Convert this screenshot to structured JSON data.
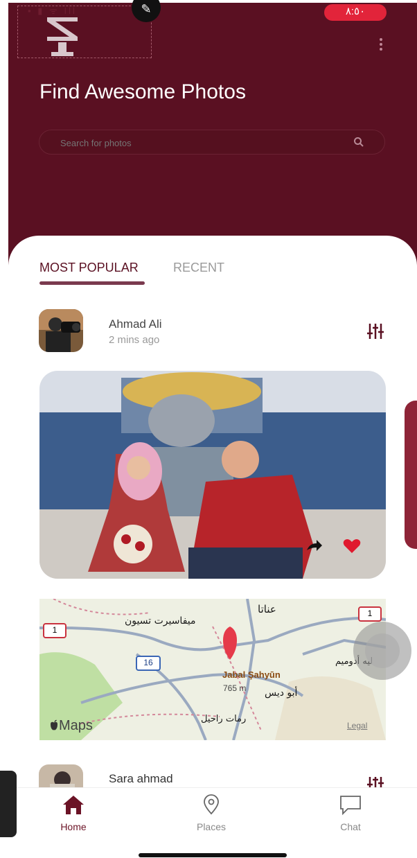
{
  "status_bar": {
    "time": "٨:٥٠",
    "icons": "▪ ▮ ᯤ Ill"
  },
  "header": {
    "title": "Find Awesome Photos",
    "search_placeholder": "Search for photos",
    "edit_icon": "✎"
  },
  "tabs": [
    {
      "label": "MOST POPULAR",
      "active": true
    },
    {
      "label": "RECENT",
      "active": false
    }
  ],
  "posts": [
    {
      "author": "Ahmad Ali",
      "time": "2 mins ago"
    },
    {
      "author": "Sara ahmad"
    }
  ],
  "map": {
    "place_name": "Jabal Şahyūn",
    "elevation": "765 m",
    "labels": [
      "عناتا",
      "ميفاسيرت تسيون",
      "ليه أدوميم",
      "أبو ديس",
      "رمات راحيل"
    ],
    "road_1": "1",
    "road_16": "16",
    "maps_label": "Maps",
    "legal_label": "Legal"
  },
  "bottom_nav": [
    {
      "label": "Home",
      "icon": "home-icon",
      "active": true
    },
    {
      "label": "Places",
      "icon": "map-pin-icon",
      "active": false
    },
    {
      "label": "Chat",
      "icon": "chat-bubble-icon",
      "active": false
    }
  ],
  "colors": {
    "primary": "#5a1022",
    "accent": "#e2243a",
    "heart": "#e0192e"
  }
}
